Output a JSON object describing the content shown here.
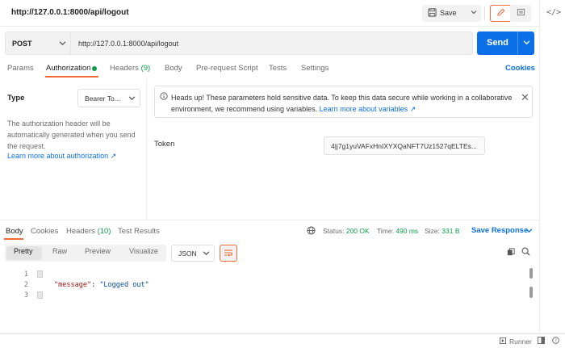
{
  "header": {
    "title": "http://127.0.0.1:8000/api/logout",
    "save_label": "Save"
  },
  "request": {
    "method": "POST",
    "url": "http://127.0.0.1:8000/api/logout",
    "send_label": "Send"
  },
  "tabs": {
    "params": "Params",
    "authorization": "Authorization",
    "headers": "Headers",
    "headers_count": "(9)",
    "body": "Body",
    "prerequest": "Pre-request Script",
    "tests": "Tests",
    "settings": "Settings",
    "cookies": "Cookies"
  },
  "auth": {
    "type_label": "Type",
    "type_value": "Bearer To...",
    "description": "The authorization header will be automatically generated when you send the request.",
    "learn_more": "Learn more about authorization ↗",
    "notice_text": "Heads up! These parameters hold sensitive data. To keep this data secure while working in a collaborative environment, we recommend using variables. ",
    "notice_link": "Learn more about variables ↗",
    "token_label": "Token",
    "token_value": "4|j7g1yuVAFxHnIXYXQaNFT7Uz1527qELTEs..."
  },
  "response": {
    "tabs": {
      "body": "Body",
      "cookies": "Cookies",
      "headers": "Headers",
      "headers_count": "(10)",
      "tests": "Test Results"
    },
    "status_label": "Status:",
    "status_value": "200 OK",
    "time_label": "Time:",
    "time_value": "490 ms",
    "size_label": "Size:",
    "size_value": "331 B",
    "save_response": "Save Response",
    "view_modes": {
      "pretty": "Pretty",
      "raw": "Raw",
      "preview": "Preview",
      "visualize": "Visualize"
    },
    "format": "JSON",
    "lines": [
      "1",
      "2",
      "3"
    ],
    "code_key": "\"message\"",
    "code_colon": ": ",
    "code_value": "\"Logged out\""
  },
  "footer": {
    "runner": "Runner"
  },
  "colors": {
    "accent": "#f26b3a",
    "primary": "#0b6fe8",
    "success": "#0c9e4c"
  }
}
